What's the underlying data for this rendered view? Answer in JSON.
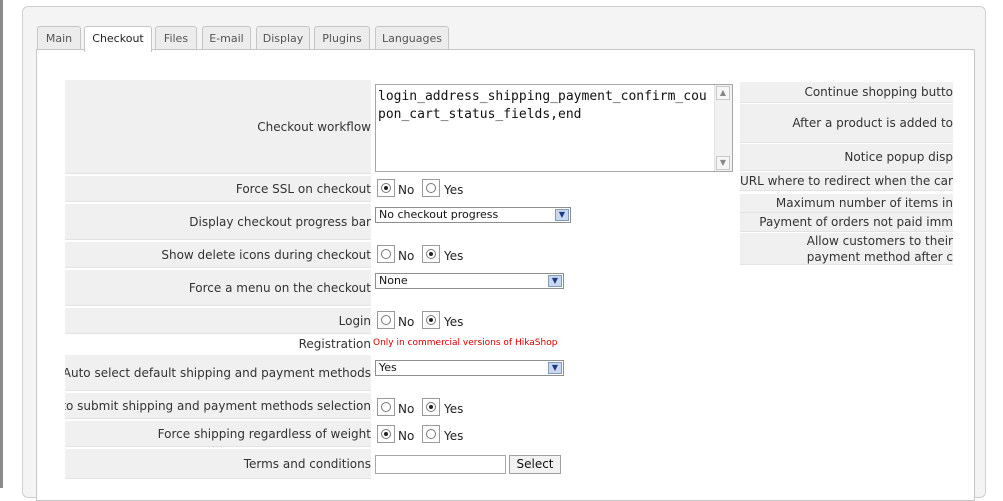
{
  "tabs": [
    {
      "label": "Main",
      "active": false
    },
    {
      "label": "Checkout",
      "active": true
    },
    {
      "label": "Files",
      "active": false
    },
    {
      "label": "E-mail",
      "active": false
    },
    {
      "label": "Display",
      "active": false
    },
    {
      "label": "Plugins",
      "active": false
    },
    {
      "label": "Languages",
      "active": false
    }
  ],
  "radio": {
    "no": "No",
    "yes": "Yes"
  },
  "settings": {
    "checkout_workflow": {
      "label": "Checkout workflow",
      "value": "login_address_shipping_payment_confirm_coupon_cart_status_fields,end"
    },
    "force_ssl": {
      "label": "Force SSL on checkout",
      "selected": "No"
    },
    "progress_bar": {
      "label": "Display checkout progress bar",
      "value": "No checkout progress"
    },
    "delete_icons": {
      "label": "Show delete icons during checkout",
      "selected": "Yes"
    },
    "force_menu": {
      "label": "Force a menu on the checkout",
      "value": "None"
    },
    "login": {
      "label": "Login",
      "selected": "Yes"
    },
    "registration": {
      "label": "Registration",
      "note": "Only in commercial versions of HikaShop"
    },
    "auto_select": {
      "label": "Auto select default shipping and payment methods",
      "value": "Yes"
    },
    "auto_submit": {
      "label": "Auto submit shipping and payment methods selection",
      "selected": "Yes"
    },
    "force_shipping": {
      "label": "Force shipping regardless of weight",
      "selected": "No"
    },
    "terms": {
      "label": "Terms and conditions",
      "value": "",
      "button": "Select"
    }
  },
  "right_column": [
    "Continue shopping butto",
    "After a product is added to",
    "Notice popup disp",
    "URL where to redirect when the cart i",
    "Maximum number of items in",
    "Payment of orders not paid imm",
    "Allow customers to their payment method after c"
  ],
  "icons": {
    "select_arrow": "chevron-down-icon",
    "scroll_up": "scroll-up-icon",
    "scroll_down": "scroll-down-icon"
  }
}
